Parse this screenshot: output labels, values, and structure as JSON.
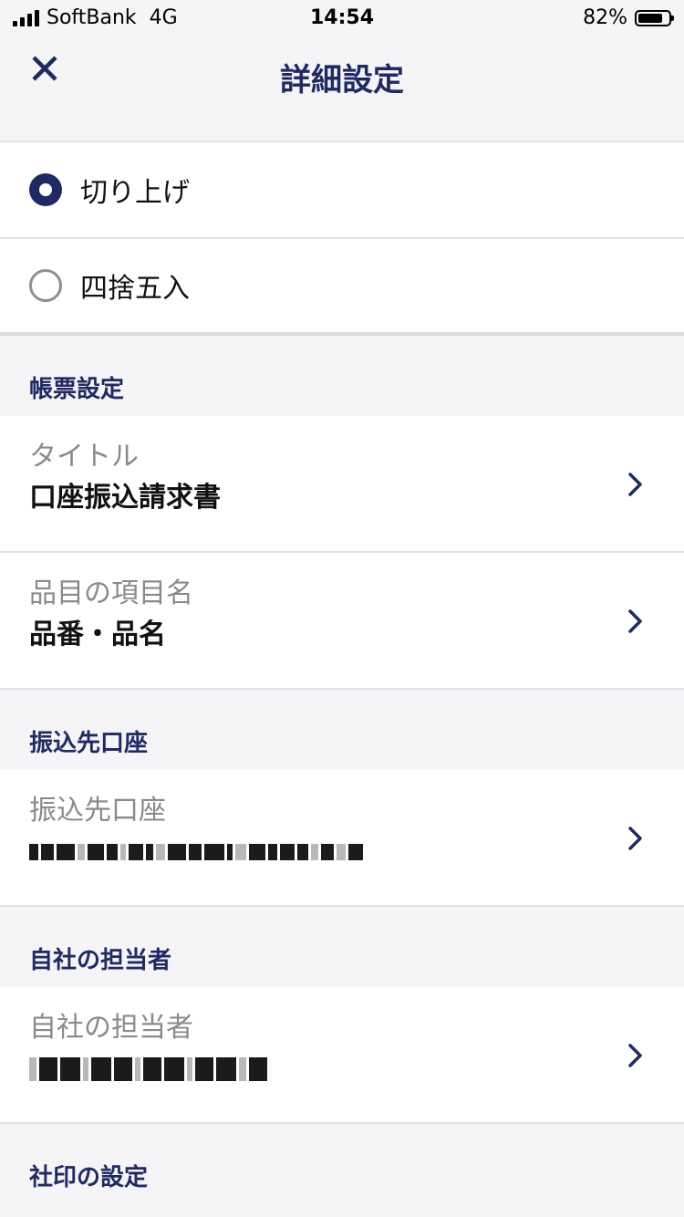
{
  "status_bar": {
    "carrier": "SoftBank",
    "network": "4G",
    "time": "14:54",
    "battery": "82%",
    "battery_level": 0.82
  },
  "header": {
    "title": "詳細設定",
    "close_icon": "close-icon"
  },
  "rounding": {
    "options": [
      {
        "label": "切り上げ",
        "selected": true
      },
      {
        "label": "四捨五入",
        "selected": false
      }
    ]
  },
  "sections": {
    "document": {
      "header": "帳票設定",
      "items": [
        {
          "label": "タイトル",
          "value": "口座振込請求書"
        },
        {
          "label": "品目の項目名",
          "value": "品番・品名"
        }
      ]
    },
    "bank_account": {
      "header": "振込先口座",
      "items": [
        {
          "label": "振込先口座",
          "value": ""
        }
      ]
    },
    "staff": {
      "header": "自社の担当者",
      "items": [
        {
          "label": "自社の担当者",
          "value": ""
        }
      ]
    },
    "seal": {
      "header": "社印の設定"
    }
  },
  "icons": {
    "chevron": "chevron-right-icon",
    "accent_color": "#1f2a63"
  }
}
